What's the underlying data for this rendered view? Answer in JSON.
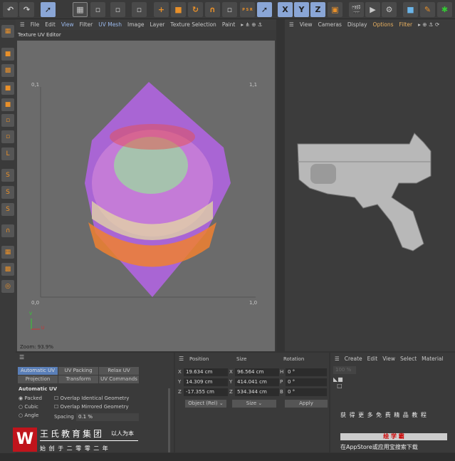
{
  "toolbar": {
    "icons": [
      "undo-icon",
      "redo-icon",
      "live-selection-icon",
      "rectangle-selection-icon",
      "move-icon",
      "scale-icon",
      "rotate-icon",
      "magnet-icon",
      "psr-icon",
      "axis-x",
      "axis-y",
      "axis-z",
      "render-view-icon",
      "render-icon",
      "render-settings-icon",
      "cube-icon",
      "pen-icon",
      "bug-icon"
    ],
    "axes": [
      "X",
      "Y",
      "Z"
    ],
    "psr": "P S R"
  },
  "uv_editor": {
    "menu": [
      "File",
      "Edit",
      "View",
      "Filter",
      "UV Mesh",
      "Image",
      "Layer",
      "Texture Selection",
      "Paint"
    ],
    "title": "Texture UV Editor",
    "labels": {
      "tl": "0,1",
      "tr": "1,1",
      "bl": "0,0",
      "br": "1,0"
    },
    "axis_v": "V",
    "axis_u": "U",
    "zoom": "Zoom: 93.9%",
    "accent": "#b464e6"
  },
  "viewport": {
    "menu": [
      "View",
      "Cameras",
      "Display",
      "Options",
      "Filter"
    ]
  },
  "uv_tools": {
    "tabs": [
      "Automatic UV",
      "UV Packing",
      "Relax UV",
      "Projection",
      "Transform",
      "UV Commands"
    ],
    "section": "Automatic UV",
    "radios": [
      {
        "label": "Packed",
        "checked": true
      },
      {
        "label": "Cubic",
        "checked": false
      },
      {
        "label": "Angle",
        "checked": false
      }
    ],
    "checks": [
      "Overlap Identical Geometry",
      "Overlap Mirrored Geometry"
    ],
    "spacing_label": "Spacing",
    "spacing": "0.1 %"
  },
  "coords": {
    "headers": [
      "Position",
      "Size",
      "Rotation"
    ],
    "rows": [
      {
        "a": "X",
        "pos": "19.634 cm",
        "b": "X",
        "size": "96.564 cm",
        "c": "H",
        "rot": "0 °"
      },
      {
        "a": "Y",
        "pos": "14.309 cm",
        "b": "Y",
        "size": "414.041 cm",
        "c": "P",
        "rot": "0 °"
      },
      {
        "a": "Z",
        "pos": "-17.355 cm",
        "b": "Z",
        "size": "534.344 cm",
        "c": "B",
        "rot": "0 °"
      }
    ],
    "mode": "Object (Rel)",
    "size_mode": "Size",
    "apply": "Apply"
  },
  "material": {
    "menu": [
      "Create",
      "Edit",
      "View",
      "Select",
      "Material"
    ],
    "zoom": "100 %"
  },
  "watermark": {
    "brand": "王氏教育集团",
    "motto": "以人为本",
    "since": "始 创 于 二 零 零 二 年",
    "promo1": "获 得 更 多 免 费 精 品 教 程",
    "promo2": "绘 学 霸",
    "promo3": "在AppStore或应用宝搜索下载"
  }
}
